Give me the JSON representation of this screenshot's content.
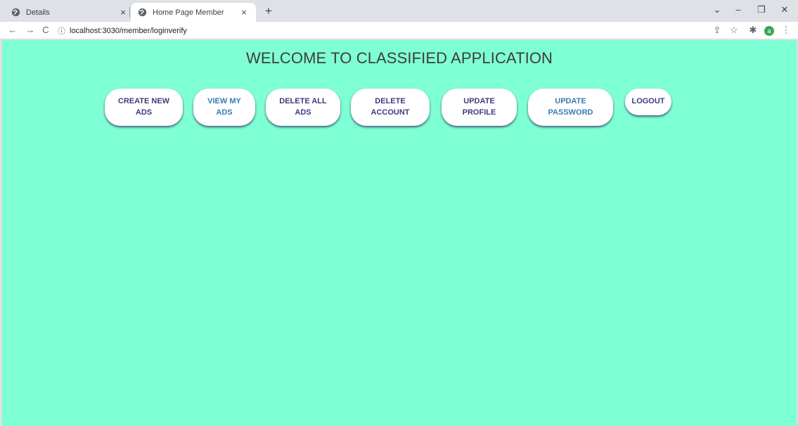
{
  "browser": {
    "tabs": [
      {
        "title": "Details",
        "close": "×"
      },
      {
        "title": "Home Page Member",
        "close": "×"
      }
    ],
    "new_tab": "+",
    "window": {
      "menu": "⌄",
      "minimize": "–",
      "restore": "❐",
      "close": "✕"
    },
    "nav": {
      "back": "←",
      "forward": "→",
      "reload": "C"
    },
    "address": {
      "info": "ⓘ",
      "url": "localhost:3030/member/loginverify"
    },
    "toolbar_icons": {
      "share": "⇪",
      "star": "☆",
      "extensions": "✱",
      "profile": "a",
      "menu": "⋮"
    }
  },
  "page": {
    "title": "WELCOME TO CLASSIFIED APPLICATION",
    "buttons": {
      "create_new_ads": {
        "line1": "CREATE NEW",
        "line2": "ADS"
      },
      "view_my_ads": {
        "line1": "VIEW MY",
        "line2": "ADS"
      },
      "delete_all_ads": {
        "line1": "DELETE ALL",
        "line2": "ADS"
      },
      "delete_account": {
        "line1": "DELETE",
        "line2": "ACCOUNT"
      },
      "update_profile": {
        "line1": "UPDATE",
        "line2": "PROFILE"
      },
      "update_password": {
        "line1": "UPDATE",
        "line2": "PASSWORD"
      },
      "logout": {
        "line1": "LOGOUT"
      }
    },
    "colors": {
      "background": "#7fffd4",
      "button_text": "#3f3a7d",
      "button_text_alt": "#3a7ab0"
    }
  }
}
